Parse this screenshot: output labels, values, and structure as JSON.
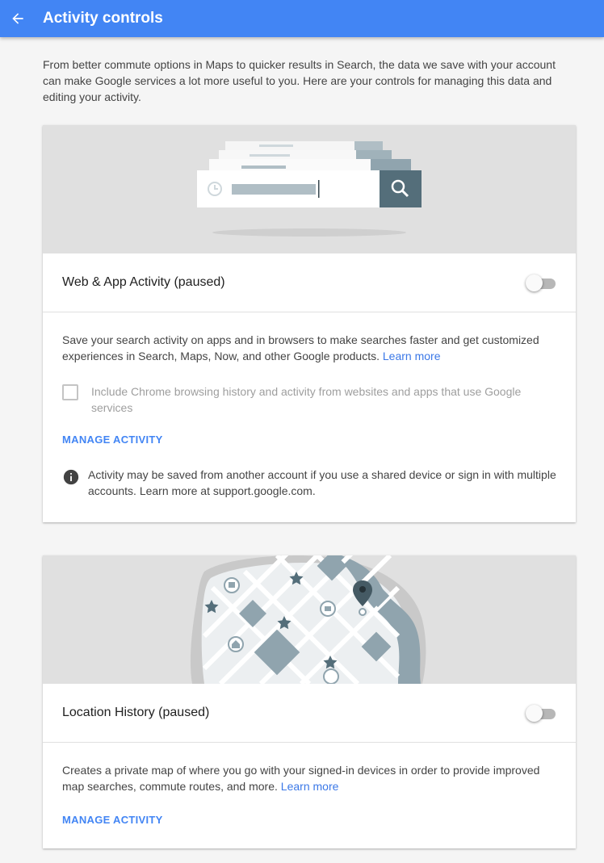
{
  "appbar": {
    "title": "Activity controls",
    "back_icon": "arrow-back-icon"
  },
  "intro": "From better commute options in Maps to quicker results in Search, the data we save with your account can make Google services a lot more useful to you. Here are your controls for managing this data and editing your activity.",
  "web_app": {
    "title": "Web & App Activity (paused)",
    "toggle_on": false,
    "description": "Save your search activity on apps and in browsers to make searches faster and get customized experiences in Search, Maps, Now, and other Google products.",
    "learn_more": "Learn more",
    "checkbox_label": "Include Chrome browsing history and activity from websites and apps that use Google services",
    "checkbox_checked": false,
    "manage": "MANAGE ACTIVITY",
    "info": "Activity may be saved from another account if you use a shared device or sign in with multiple accounts. Learn more at support.google.com."
  },
  "location": {
    "title": "Location History (paused)",
    "toggle_on": false,
    "description": "Creates a private map of where you go with your signed-in devices in order to provide improved map searches, commute routes, and more.",
    "learn_more": "Learn more",
    "manage": "MANAGE ACTIVITY"
  },
  "colors": {
    "appbar": "#4285f4",
    "link": "#3b78e7",
    "slate": "#5f7a87"
  }
}
